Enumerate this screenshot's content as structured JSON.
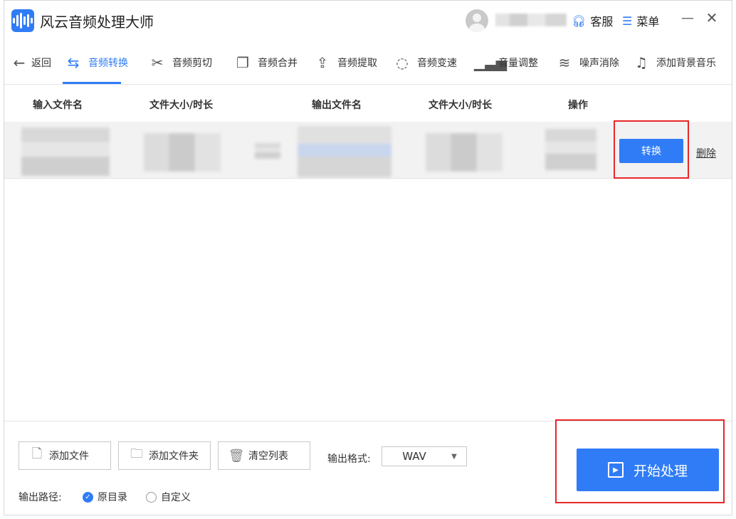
{
  "app": {
    "title": "风云音频处理大师"
  },
  "header": {
    "service_label": "客服",
    "menu_label": "菜单",
    "minimize": "—",
    "close": "✕"
  },
  "toolbar": {
    "back": "返回",
    "tools": [
      "音频转换",
      "音频剪切",
      "音频合并",
      "音频提取",
      "音频变速",
      "音量调整",
      "噪声消除",
      "添加背景音乐"
    ]
  },
  "table": {
    "headers": [
      "输入文件名",
      "文件大小/时长",
      "输出文件名",
      "文件大小/时长",
      "操作"
    ],
    "rows": [
      {
        "convert_label": "转换",
        "delete_label": "删除"
      }
    ]
  },
  "bottom": {
    "add_file": "添加文件",
    "add_folder": "添加文件夹",
    "clear_list": "清空列表",
    "format_label": "输出格式:",
    "format_value": "WAV",
    "path_label": "输出路径:",
    "path_options": [
      "原目录",
      "自定义"
    ],
    "path_selected": "原目录",
    "start_label": "开始处理"
  },
  "colors": {
    "accent": "#2f7cf6",
    "highlight": "#e8262a"
  }
}
